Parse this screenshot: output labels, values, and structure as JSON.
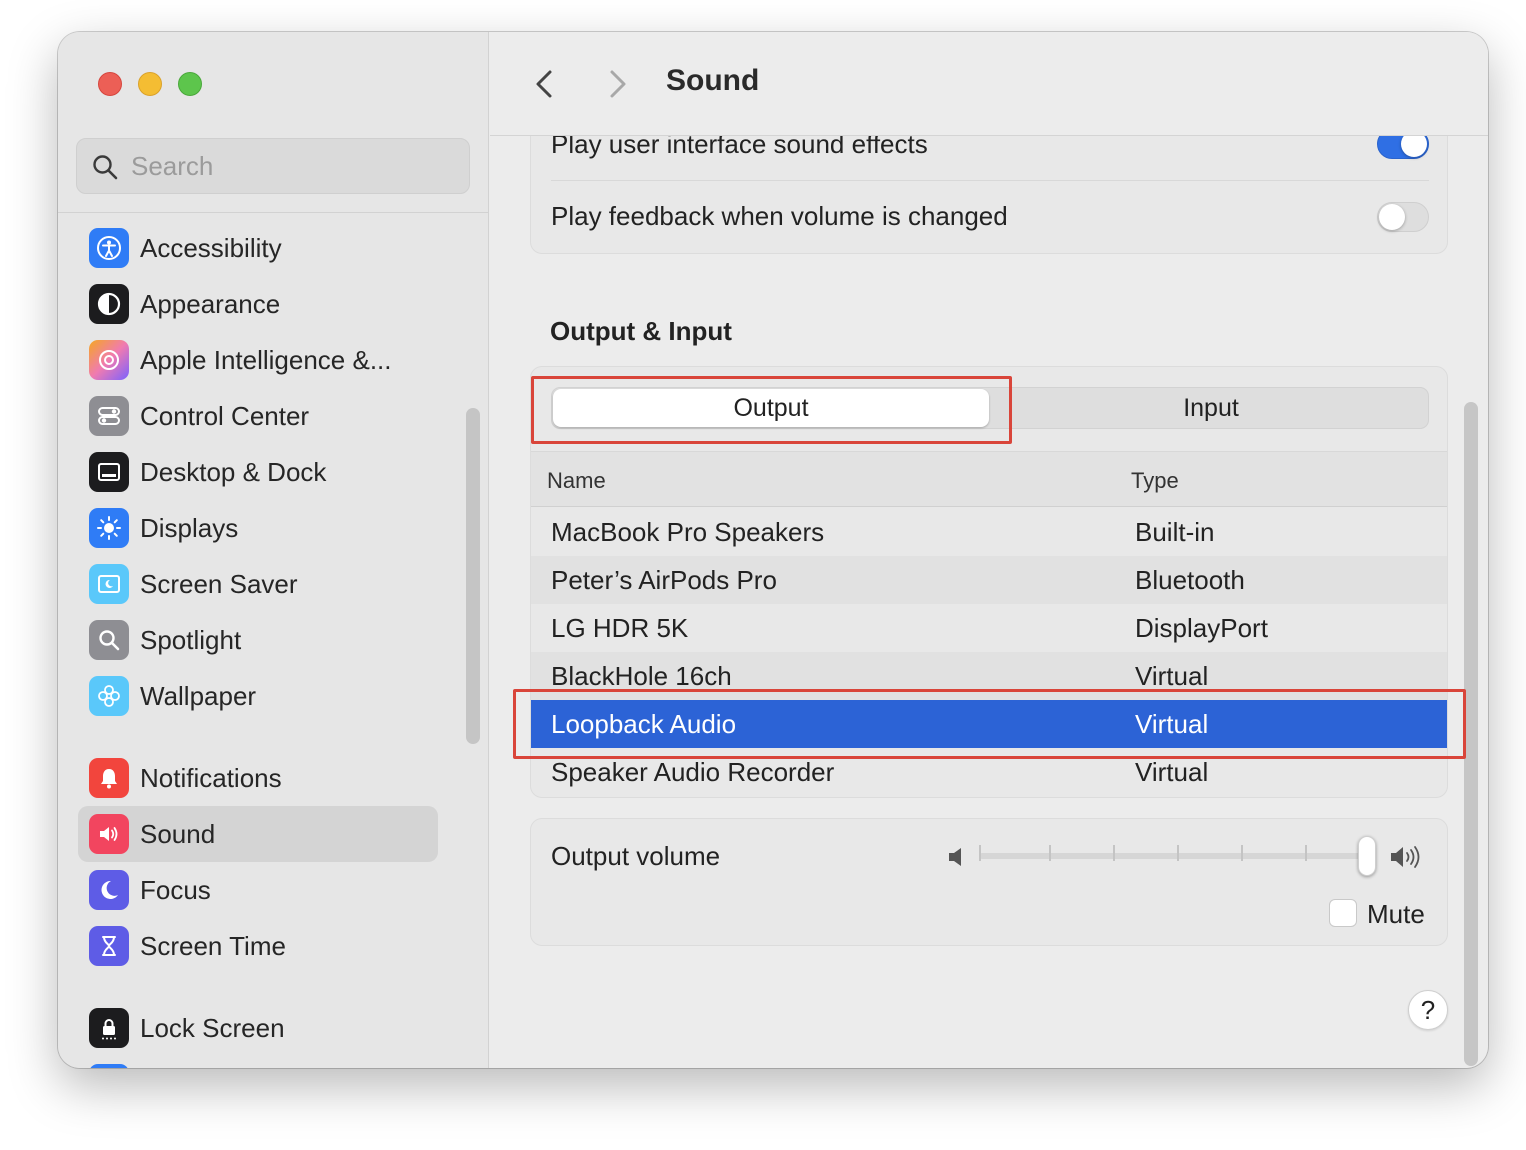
{
  "sidebar": {
    "search_placeholder": "Search",
    "items": [
      {
        "label": "Accessibility",
        "icon": "accessibility-icon",
        "color": "#2f7cf6"
      },
      {
        "label": "Appearance",
        "icon": "appearance-icon",
        "color": "#1c1c1e"
      },
      {
        "label": "Apple Intelligence &...",
        "icon": "apple-intelligence-icon",
        "color": "#f07bb0"
      },
      {
        "label": "Control Center",
        "icon": "control-center-icon",
        "color": "#8e8e93"
      },
      {
        "label": "Desktop & Dock",
        "icon": "desktop-dock-icon",
        "color": "#1c1c1e"
      },
      {
        "label": "Displays",
        "icon": "displays-icon",
        "color": "#2f7cf6"
      },
      {
        "label": "Screen Saver",
        "icon": "screen-saver-icon",
        "color": "#5ac8fa"
      },
      {
        "label": "Spotlight",
        "icon": "spotlight-icon",
        "color": "#8e8e93"
      },
      {
        "label": "Wallpaper",
        "icon": "wallpaper-icon",
        "color": "#5ac8fa"
      },
      {
        "label": "Notifications",
        "icon": "notifications-icon",
        "color": "#f2453d"
      },
      {
        "label": "Sound",
        "icon": "sound-icon",
        "color": "#f2455f",
        "selected": true
      },
      {
        "label": "Focus",
        "icon": "focus-icon",
        "color": "#5e5ce6"
      },
      {
        "label": "Screen Time",
        "icon": "screen-time-icon",
        "color": "#5e5ce6"
      },
      {
        "label": "Lock Screen",
        "icon": "lock-screen-icon",
        "color": "#1c1c1e"
      }
    ]
  },
  "toolbar": {
    "title": "Sound"
  },
  "sound_effects": {
    "ui_sounds_label": "Play user interface sound effects",
    "ui_sounds_on": true,
    "feedback_label": "Play feedback when volume is changed",
    "feedback_on": false
  },
  "output_input": {
    "section_title": "Output & Input",
    "tabs": [
      "Output",
      "Input"
    ],
    "active_tab": "Output",
    "columns": [
      "Name",
      "Type"
    ],
    "rows": [
      {
        "name": "MacBook Pro Speakers",
        "type": "Built-in"
      },
      {
        "name": "Peter’s AirPods Pro",
        "type": "Bluetooth"
      },
      {
        "name": "LG HDR 5K",
        "type": "DisplayPort"
      },
      {
        "name": "BlackHole 16ch",
        "type": "Virtual"
      },
      {
        "name": "Loopback Audio",
        "type": "Virtual",
        "selected": true
      },
      {
        "name": "Speaker Audio Recorder",
        "type": "Virtual"
      }
    ]
  },
  "output_volume": {
    "label": "Output volume",
    "level": 0.99,
    "mute_label": "Mute",
    "muted": false
  },
  "help_label": "?",
  "colors": {
    "accent": "#2c63d6",
    "annotation": "#d9453a"
  }
}
